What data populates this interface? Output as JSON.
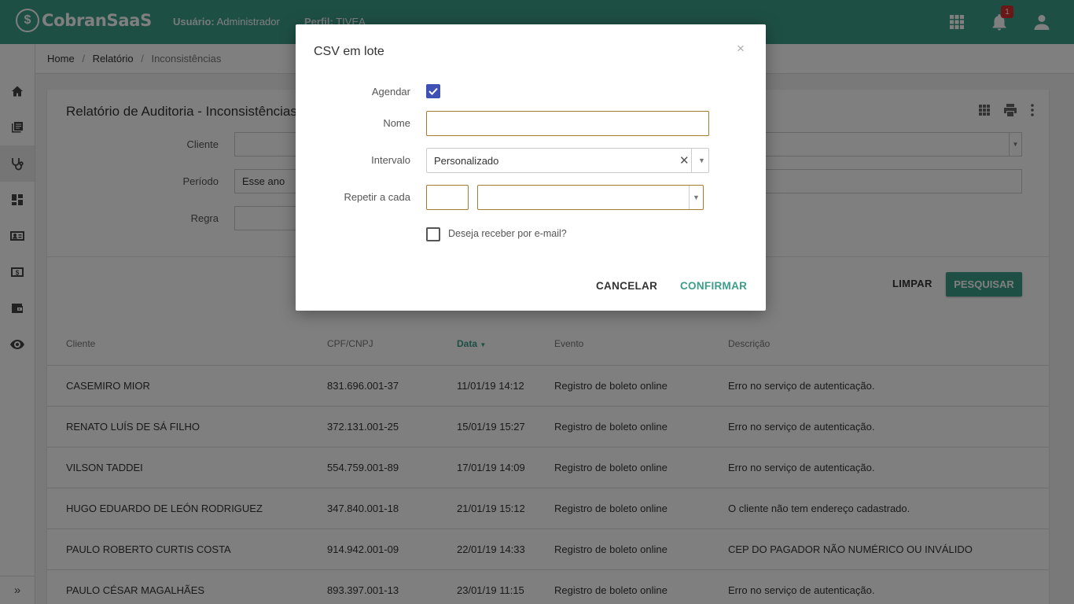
{
  "header": {
    "brand": "CobranSaaS",
    "logo_glyph": "$",
    "user_label": "Usuário:",
    "user_value": "Administrador",
    "perfil_label": "Perfil:",
    "perfil_value": "TIVEA",
    "notification_count": "1",
    "color": "#3c9e8a"
  },
  "sidebar": {
    "items": [
      "home-icon",
      "book-icon",
      "stethoscope-icon",
      "dashboard-icon",
      "contact-card-icon",
      "money-icon",
      "wallet-icon",
      "eye-icon"
    ],
    "active": "stethoscope-icon",
    "expand_glyph": "»"
  },
  "breadcrumb": {
    "items": [
      "Home",
      "Relatório"
    ],
    "separator": "/",
    "current": "Inconsistências"
  },
  "page": {
    "title": "Relatório de Auditoria - Inconsistências",
    "filters": {
      "cliente_label": "Cliente",
      "periodo_label": "Período",
      "periodo_value": "Esse ano",
      "regra_label": "Regra"
    },
    "limpar_label": "LIMPAR",
    "pesquisar_label": "PESQUISAR"
  },
  "table": {
    "columns": [
      "Cliente",
      "CPF/CNPJ",
      "Data",
      "Evento",
      "Descrição"
    ],
    "sorted_column": "Data",
    "rows": [
      [
        "CASEMIRO MIOR",
        "831.696.001-37",
        "11/01/19 14:12",
        "Registro de boleto online",
        "Erro no serviço de autenticação."
      ],
      [
        "RENATO LUÍS DE SÁ FILHO",
        "372.131.001-25",
        "15/01/19 15:27",
        "Registro de boleto online",
        "Erro no serviço de autenticação."
      ],
      [
        "VILSON TADDEI",
        "554.759.001-89",
        "17/01/19 14:09",
        "Registro de boleto online",
        "Erro no serviço de autenticação."
      ],
      [
        "HUGO EDUARDO DE LEÓN RODRIGUEZ",
        "347.840.001-18",
        "21/01/19 15:12",
        "Registro de boleto online",
        "O cliente não tem endereço cadastrado."
      ],
      [
        "PAULO ROBERTO CURTIS COSTA",
        "914.942.001-09",
        "22/01/19 14:33",
        "Registro de boleto online",
        "CEP DO PAGADOR NÃO NUMÉRICO OU INVÁLIDO"
      ],
      [
        "PAULO CÉSAR MAGALHÃES",
        "893.397.001-13",
        "23/01/19 11:15",
        "Registro de boleto online",
        "Erro no serviço de autenticação."
      ]
    ]
  },
  "modal": {
    "title": "CSV em lote",
    "close_glyph": "×",
    "agendar_label": "Agendar",
    "agendar_checked": true,
    "nome_label": "Nome",
    "nome_value": "",
    "intervalo_label": "Intervalo",
    "intervalo_value": "Personalizado",
    "repetir_label": "Repetir a cada",
    "repetir_value": "",
    "repetir_unit": "",
    "email_label": "Deseja receber por e-mail?",
    "email_checked": false,
    "cancel_label": "CANCELAR",
    "confirm_label": "CONFIRMAR"
  }
}
